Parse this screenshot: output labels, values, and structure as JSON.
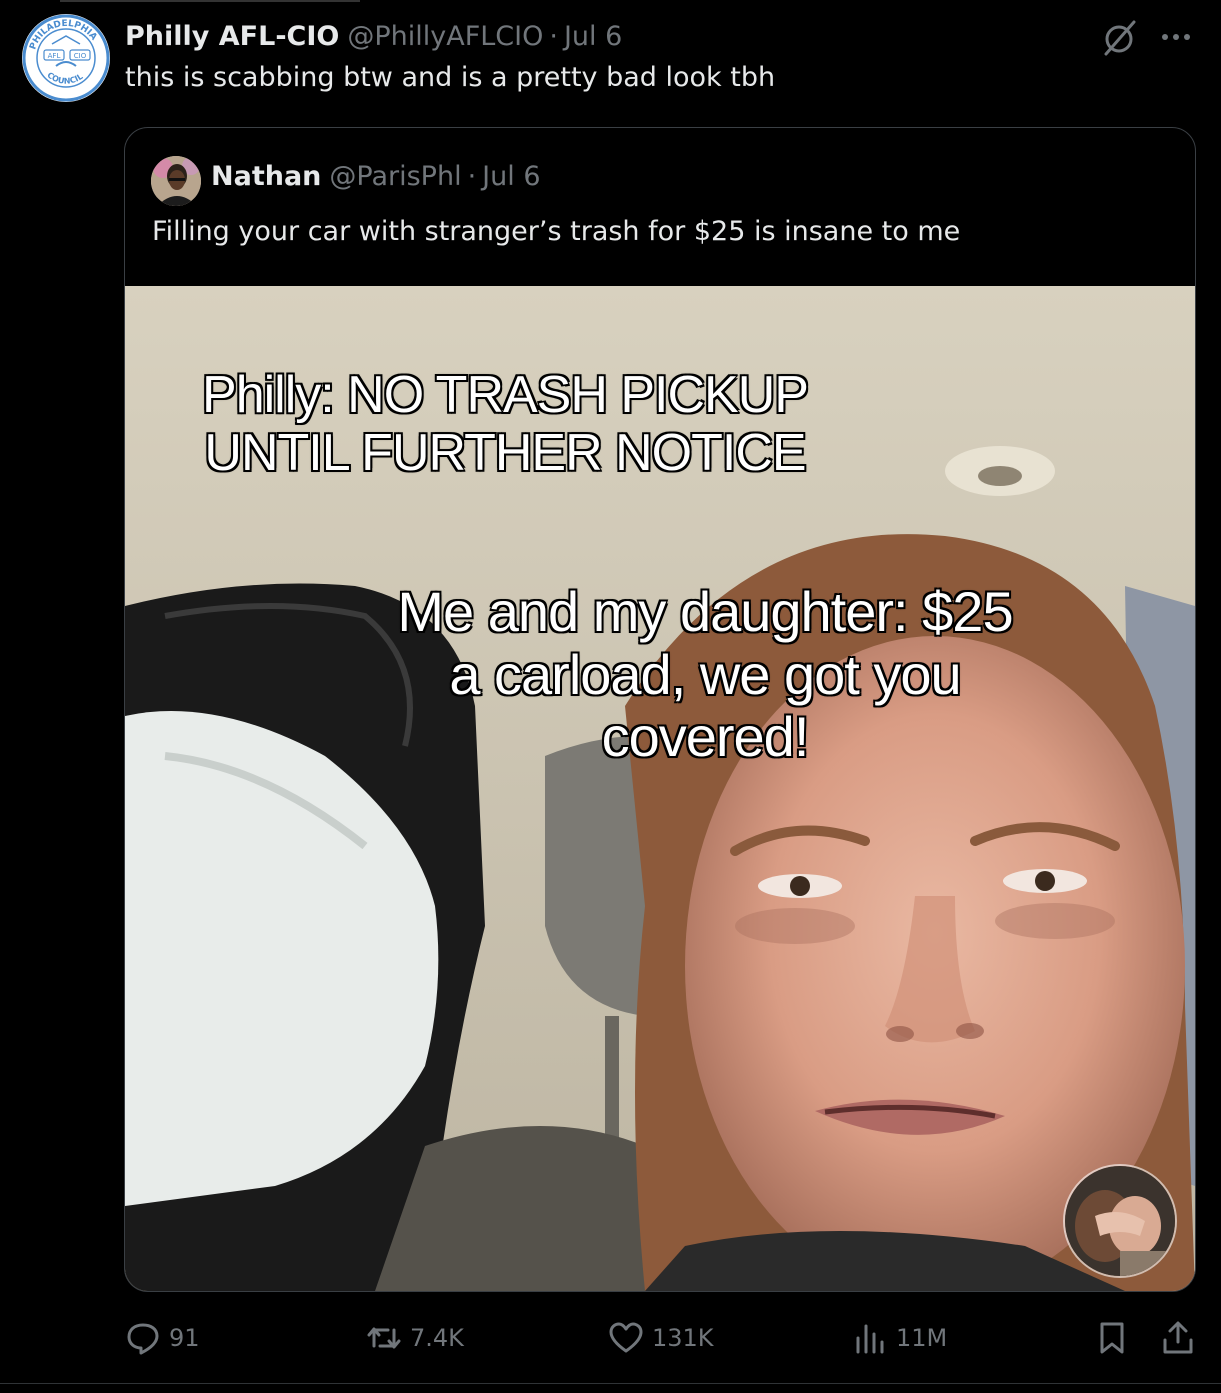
{
  "tweet": {
    "author_name": "Philly AFL-CIO",
    "author_handle": "@PhillyAFLCIO",
    "separator": "·",
    "date": "Jul 6",
    "text": "this is scabbing btw and is a pretty bad look tbh",
    "avatar_logo_texts": [
      "PHILADELPHIA",
      "AFL",
      "CIO",
      "COUNCIL"
    ]
  },
  "quoted": {
    "author_name": "Nathan",
    "author_handle": "@ParisPhl",
    "separator": "·",
    "date": "Jul 6",
    "text": "Filling your car with stranger’s trash for $25 is insane to me",
    "video_captions": {
      "line1": [
        "Philly: NO TRASH PICKUP",
        "UNTIL FURTHER NOTICE"
      ],
      "line2": [
        "Me and my daughter: $25",
        "a carload, we got you",
        "covered!"
      ]
    }
  },
  "actions": {
    "replies": "91",
    "reposts": "7.4K",
    "likes": "131K",
    "views": "11M"
  },
  "icons": {
    "grok": "grok-icon",
    "more": "more-icon",
    "reply": "reply-icon",
    "repost": "repost-icon",
    "like": "heart-icon",
    "views": "views-chart-icon",
    "bookmark": "bookmark-icon",
    "share": "share-icon"
  },
  "colors": {
    "background": "#000000",
    "text_primary": "#e7e9ea",
    "text_secondary": "#71767b",
    "border": "#3a3f44",
    "logo_blue": "#4a8ccf"
  }
}
